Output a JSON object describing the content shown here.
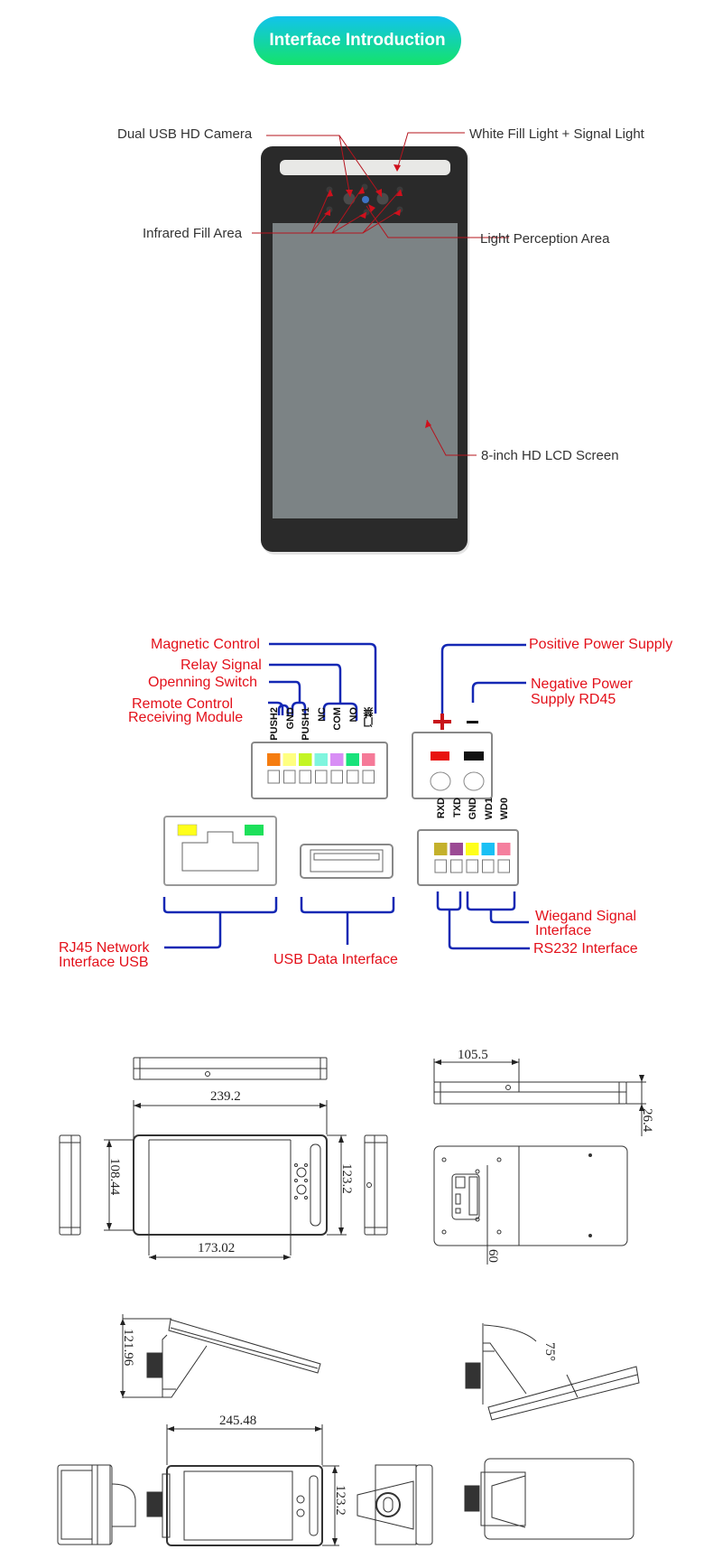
{
  "header": {
    "title": "Interface Introduction"
  },
  "device_front": {
    "labels": {
      "camera": "Dual USB HD Camera",
      "fill_light": "White Fill Light + Signal Light",
      "infrared": "Infrared Fill Area",
      "light_perception": "Light Perception Area",
      "lcd": "8-inch HD LCD Screen"
    }
  },
  "wiring": {
    "labels": {
      "magnetic": "Magnetic Control",
      "relay": "Relay Signal",
      "opening": "Openning Switch",
      "remote_line1": "Remote Control",
      "remote_line2": "Receiving  Module",
      "positive": "Positive Power Supply",
      "negative_line1": "Negative Power",
      "negative_line2": "Supply RD45",
      "wiegand_line1": "Wiegand Signal",
      "wiegand_line2": "Interface",
      "rs232": "RS232 Interface",
      "rj45_line1": "RJ45 Network",
      "rj45_line2": "Interface USB",
      "usb": "USB Data Interface"
    },
    "terminal_main": {
      "pins": [
        "PUSH2",
        "GND",
        "PUSH1",
        "NC",
        "COM",
        "NO",
        "门禁"
      ],
      "colors": [
        "#f57c0f",
        "#ffff80",
        "#c3f524",
        "#7ff5de",
        "#d88ef5",
        "#18e27a",
        "#f57a98"
      ]
    },
    "terminal_power": {
      "symbols": [
        "+",
        "−"
      ],
      "colors": [
        "#e8130f",
        "#111111"
      ]
    },
    "terminal_serial": {
      "pins": [
        "RXD",
        "TXD",
        "GND",
        "WD1",
        "WD0"
      ],
      "colors": [
        "#c4b12c",
        "#9b4a94",
        "#ffff19",
        "#1ac0f5",
        "#f57f9e"
      ]
    },
    "rj45_leds": [
      "#ffff1a",
      "#1de05a"
    ],
    "line_color": "#1428b4"
  },
  "dimensions": {
    "front_width": "239.2",
    "front_height_inner": "108.44",
    "front_height": "123.2",
    "screen_width": "173.02",
    "back_offset": "105.5",
    "depth": "26.4",
    "mount_spacing": "60",
    "stand_height": "121.96",
    "tilt_angle": "75°",
    "stand_width": "245.48",
    "stand_height_front": "123.2"
  }
}
